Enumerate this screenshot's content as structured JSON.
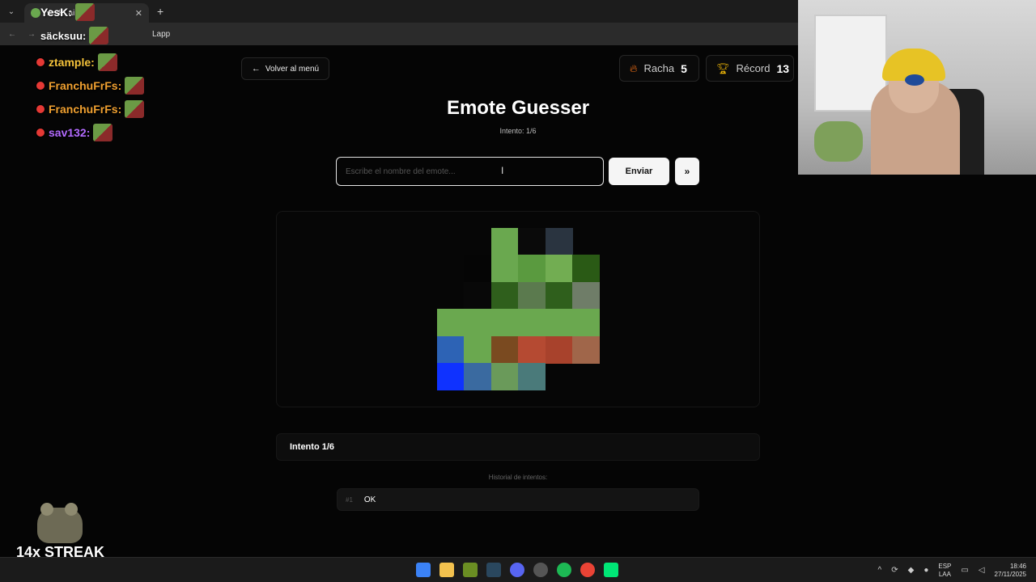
{
  "browser": {
    "tab_title": "YesK: ai",
    "address_text": "Lapp"
  },
  "chat": [
    {
      "user": "ztample:",
      "color": "#f5c33b"
    },
    {
      "user": "FranchuFrFs:",
      "color": "#f0a030"
    },
    {
      "user": "FranchuFrFs:",
      "color": "#f0a030"
    },
    {
      "user": "sav132:",
      "color": "#b36bff"
    }
  ],
  "chat_top": {
    "line1": "YesK:",
    "line2": "säcksuu:"
  },
  "nav": {
    "back_label": "Volver al menú"
  },
  "stats": {
    "streak_label": "Racha",
    "streak_value": "5",
    "record_label": "Récord",
    "record_value": "13"
  },
  "game": {
    "title": "Emote Guesser",
    "attempt_text": "Intento: 1/6",
    "input_placeholder": "Escribe el nombre del emote...",
    "send_label": "Enviar",
    "skip_label": "»",
    "attempt_bar": "Intento 1/6",
    "history_label": "Historial de intentos:",
    "history": [
      {
        "num": "#1",
        "guess": "OK"
      }
    ]
  },
  "streak_overlay": {
    "text": "14x STREAK"
  },
  "taskbar": {
    "lang_top": "ESP",
    "lang_bottom": "LAA",
    "time": "18:46",
    "date": "27/11/2025"
  }
}
